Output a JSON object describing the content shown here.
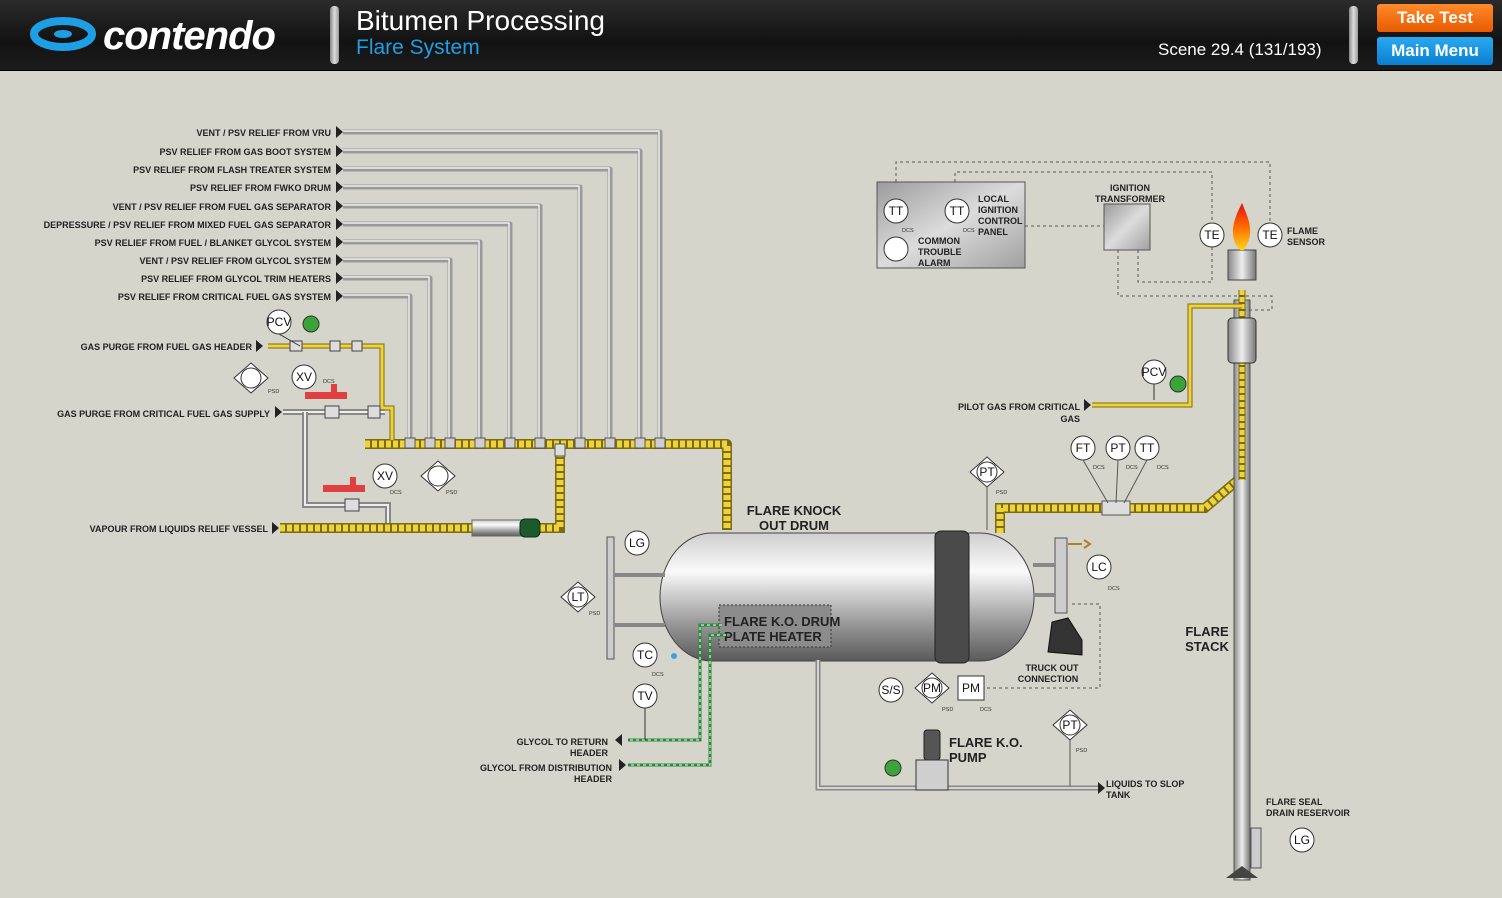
{
  "header": {
    "logo": "contendo",
    "course_title": "Bitumen Processing",
    "module_title": "Flare System",
    "scene": "Scene 29.4 (131/193)",
    "take_test": "Take Test",
    "main_menu": "Main Menu"
  },
  "colors": {
    "accent_blue": "#1e9fe5",
    "take_test": "#f07010",
    "main_menu": "#1a93e0",
    "gas_line": "#f0d23a",
    "background": "#d6d5cb"
  },
  "inlets": [
    "VENT / PSV RELIEF FROM VRU",
    "PSV RELIEF FROM GAS BOOT SYSTEM",
    "PSV RELIEF FROM FLASH TREATER SYSTEM",
    "PSV RELIEF FROM FWKO DRUM",
    "VENT / PSV RELIEF FROM FUEL GAS SEPARATOR",
    "DEPRESSURE / PSV RELIEF FROM MIXED FUEL GAS SEPARATOR",
    "PSV RELIEF FROM FUEL / BLANKET GLYCOL SYSTEM",
    "VENT / PSV RELIEF FROM GLYCOL SYSTEM",
    "PSV RELIEF FROM GLYCOL TRIM HEATERS",
    "PSV RELIEF FROM CRITICAL FUEL GAS SYSTEM"
  ],
  "labels": {
    "gas_purge_fuel": "GAS PURGE FROM FUEL GAS HEADER",
    "gas_purge_critical": "GAS PURGE FROM CRITICAL FUEL GAS SUPPLY",
    "vapour": "VAPOUR FROM LIQUIDS RELIEF VESSEL",
    "drum_title": [
      "FLARE KNOCK",
      "OUT DRUM"
    ],
    "heater": [
      "FLARE K.O. DRUM",
      "PLATE HEATER"
    ],
    "glycol_return": [
      "GLYCOL TO RETURN",
      "HEADER"
    ],
    "glycol_dist": [
      "GLYCOL FROM DISTRIBUTION",
      "HEADER"
    ],
    "truck": [
      "TRUCK OUT",
      "CONNECTION"
    ],
    "pump": [
      "FLARE K.O.",
      "PUMP"
    ],
    "slop": [
      "LIQUIDS TO SLOP",
      "TANK"
    ],
    "stack": [
      "FLARE",
      "STACK"
    ],
    "seal": [
      "FLARE SEAL",
      "DRAIN RESERVOIR"
    ],
    "pilot": [
      "PILOT GAS FROM CRITICAL",
      "GAS"
    ],
    "panel": [
      "LOCAL",
      "IGNITION",
      "CONTROL",
      "PANEL"
    ],
    "alarm": [
      "COMMON",
      "TROUBLE",
      "ALARM"
    ],
    "ignition": [
      "IGNITION",
      "TRANSFORMER"
    ],
    "flame_sensor": [
      "FLAME",
      "SENSOR"
    ]
  },
  "instruments": {
    "pcv1": "PCV",
    "xv1": "XV",
    "xv2": "XV",
    "lg1": "LG",
    "lt1": "LT",
    "tc1": "TC",
    "tv1": "TV",
    "lc1": "LC",
    "pt_drum": "PT",
    "ss": "S/S",
    "pm1": "PM",
    "pm2": "PM",
    "pt_pump": "PT",
    "ft": "FT",
    "pt_flare": "PT",
    "tt_flare": "TT",
    "pcv2": "PCV",
    "tt1": "TT",
    "tt2": "TT",
    "te1": "TE",
    "te2": "TE",
    "lg2": "LG"
  },
  "tags": {
    "dcs": "DCS",
    "psd": "PSD"
  }
}
